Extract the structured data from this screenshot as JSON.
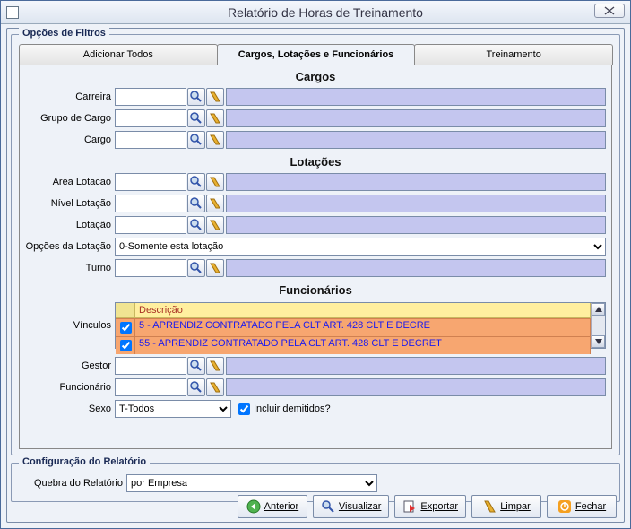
{
  "window": {
    "title": "Relatório de Horas de Treinamento"
  },
  "filtros": {
    "legend": "Opções de Filtros",
    "tabs": [
      {
        "label": "Adicionar Todos"
      },
      {
        "label": "Cargos, Lotações e Funcionários"
      },
      {
        "label": "Treinamento"
      }
    ],
    "sections": {
      "cargos": {
        "title": "Cargos"
      },
      "lotacoes": {
        "title": "Lotações"
      },
      "funcionarios": {
        "title": "Funcionários"
      }
    },
    "labels": {
      "carreira": "Carreira",
      "grupo_cargo": "Grupo de Cargo",
      "cargo": "Cargo",
      "area_lotacao": "Area Lotacao",
      "nivel_lotacao": "Nível Lotação",
      "lotacao": "Lotação",
      "opcoes_lotacao": "Opções da Lotação",
      "turno": "Turno",
      "vinculos": "Vínculos",
      "gestor": "Gestor",
      "funcionario": "Funcionário",
      "sexo": "Sexo",
      "incluir_demitidos": "Incluir demitidos?"
    },
    "values": {
      "carreira": "",
      "grupo_cargo": "",
      "cargo": "",
      "area_lotacao": "",
      "nivel_lotacao": "",
      "lotacao": "",
      "opcoes_lotacao": "0-Somente esta lotação",
      "turno": "",
      "gestor": "",
      "funcionario": "",
      "sexo": "T-Todos",
      "incluir_demitidos": true
    },
    "vinculos_grid": {
      "header": "Descrição",
      "rows": [
        {
          "checked": true,
          "descricao": "5 - APRENDIZ CONTRATADO PELA CLT ART. 428 CLT E DECRE"
        },
        {
          "checked": true,
          "descricao": "55 - APRENDIZ CONTRATADO PELA CLT ART. 428 CLT E DECRET"
        }
      ]
    }
  },
  "config": {
    "legend": "Configuração do Relatório",
    "labels": {
      "quebra": "Quebra do Relatório"
    },
    "values": {
      "quebra": "por Empresa"
    }
  },
  "buttons": {
    "anterior": "Anterior",
    "visualizar": "Visualizar",
    "exportar": "Exportar",
    "limpar": "Limpar",
    "fechar": "Fechar"
  }
}
